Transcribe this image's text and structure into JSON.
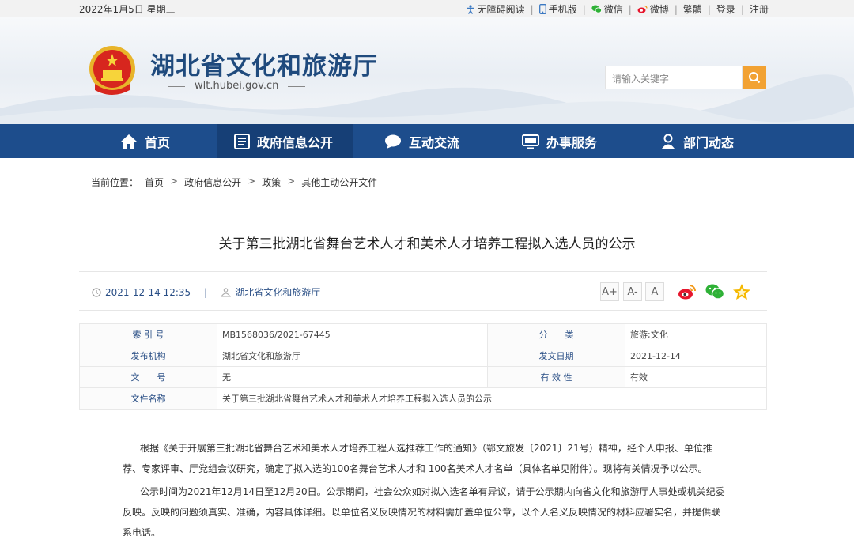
{
  "topbar": {
    "date": "2022年1月5日 星期三",
    "links": [
      {
        "icon": "accessibility-icon",
        "label": "无障碍阅读"
      },
      {
        "icon": "mobile-icon",
        "label": "手机版"
      },
      {
        "icon": "wechat-icon",
        "label": "微信"
      },
      {
        "icon": "weibo-icon",
        "label": "微博"
      },
      {
        "icon": "",
        "label": "繁體"
      },
      {
        "icon": "",
        "label": "登录"
      },
      {
        "icon": "",
        "label": "注册"
      }
    ]
  },
  "header": {
    "title": "湖北省文化和旅游厅",
    "url": "wlt.hubei.gov.cn",
    "search_placeholder": "请输入关键字"
  },
  "nav": [
    {
      "label": "首页",
      "icon": "home-icon"
    },
    {
      "label": "政府信息公开",
      "icon": "document-icon"
    },
    {
      "label": "互动交流",
      "icon": "chat-icon"
    },
    {
      "label": "办事服务",
      "icon": "monitor-icon"
    },
    {
      "label": "部门动态",
      "icon": "person-icon"
    }
  ],
  "breadcrumb": {
    "prefix": "当前位置：",
    "items": [
      "首页",
      "政府信息公开",
      "政策",
      "其他主动公开文件"
    ]
  },
  "article": {
    "title": "关于第三批湖北省舞台艺术人才和美术人才培养工程拟入选人员的公示",
    "datetime": "2021-12-14 12:35",
    "source": "湖北省文化和旅游厅",
    "font_sizes": [
      "A+",
      "A-",
      "A"
    ]
  },
  "info_table": {
    "rows": [
      {
        "k1": "索 引 号",
        "v1": "MB1568036/2021-67445",
        "k2": "分　　类",
        "v2": "旅游;文化"
      },
      {
        "k1": "发布机构",
        "v1": "湖北省文化和旅游厅",
        "k2": "发文日期",
        "v2": "2021-12-14"
      },
      {
        "k1": "文　　号",
        "v1": "无",
        "k2": "有 效 性",
        "v2": "有效"
      }
    ],
    "name_key": "文件名称",
    "name_value": "关于第三批湖北省舞台艺术人才和美术人才培养工程拟入选人员的公示"
  },
  "body": {
    "p1": "根据《关于开展第三批湖北省舞台艺术和美术人才培养工程人选推荐工作的通知》（鄂文旅发〔2021〕21号）精神，经个人申报、单位推荐、专家评审、厅党组会议研究，确定了拟入选的100名舞台艺术人才和 100名美术人才名单（具体名单见附件）。现将有关情况予以公示。",
    "p2": "公示时间为2021年12月14日至12月20日。公示期间，社会公众如对拟入选名单有异议，请于公示期内向省文化和旅游厅人事处或机关纪委反映。反映的问题须真实、准确，内容具体详细。以单位名义反映情况的材料需加盖单位公章，以个人名义反映情况的材料应署实名，并提供联系电话。"
  },
  "colors": {
    "nav": "#1d4d8c",
    "accent": "#f2a233",
    "link": "#2a4f86"
  }
}
